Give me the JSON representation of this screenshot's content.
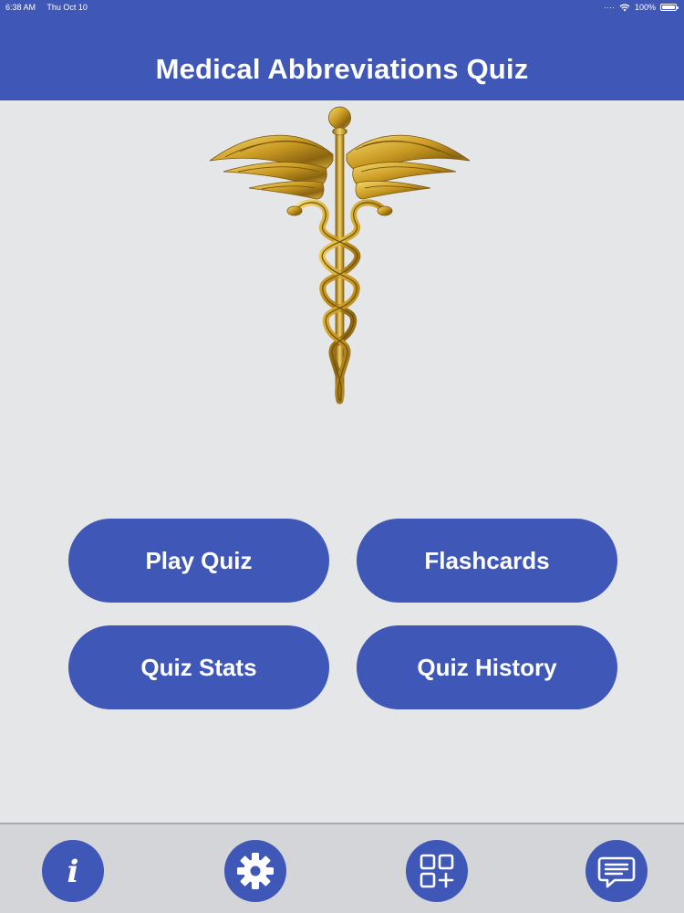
{
  "status_bar": {
    "time": "6:38 AM",
    "date": "Thu Oct 10",
    "battery": "100%"
  },
  "header": {
    "title": "Medical Abbreviations Quiz"
  },
  "logo": {
    "icon": "caduceus-icon",
    "color": "#c9a12a"
  },
  "menu": {
    "play_quiz": "Play Quiz",
    "flashcards": "Flashcards",
    "quiz_stats": "Quiz Stats",
    "quiz_history": "Quiz History"
  },
  "tabbar": {
    "items": [
      {
        "icon": "info-icon"
      },
      {
        "icon": "gear-icon"
      },
      {
        "icon": "apps-add-icon"
      },
      {
        "icon": "chat-bubble-icon"
      }
    ]
  },
  "colors": {
    "primary": "#3f57b6",
    "background": "#e4e6e7",
    "tabbar": "#d3d5d8"
  }
}
